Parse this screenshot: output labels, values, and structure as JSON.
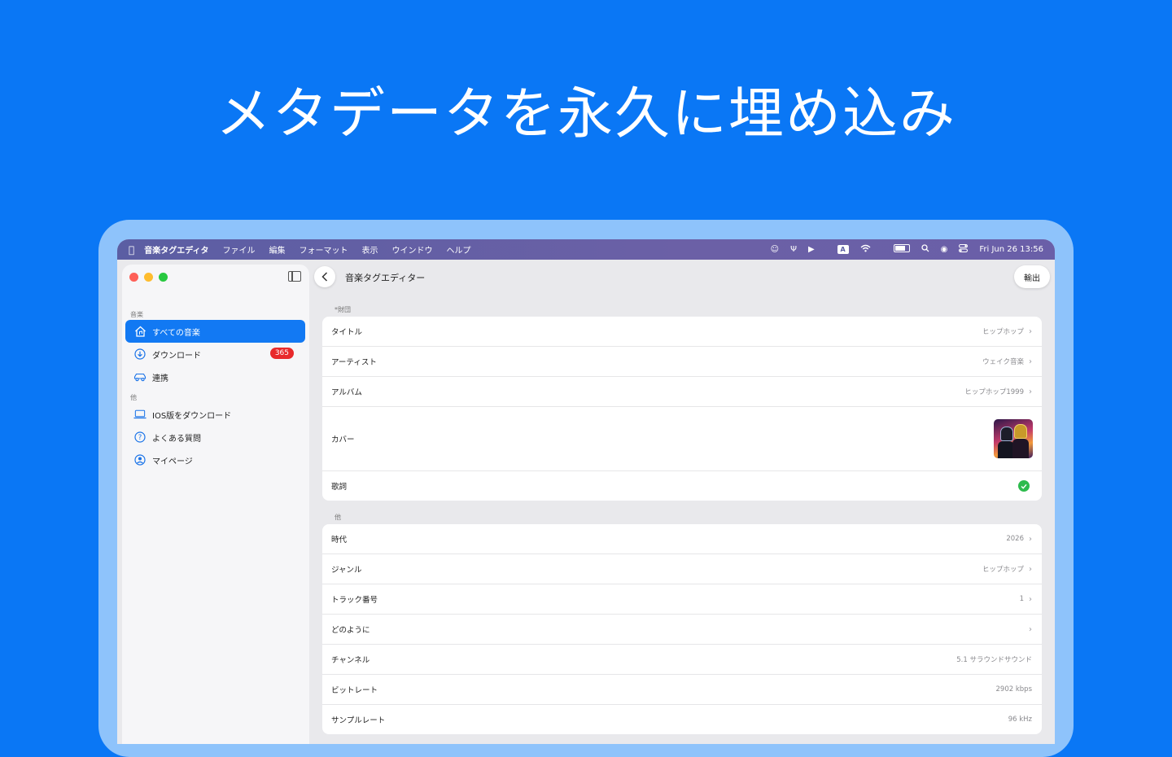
{
  "headline": "メタデータを永久に埋め込み",
  "menubar": {
    "app_name": "音楽タグエディタ",
    "items": [
      "ファイル",
      "編集",
      "フォーマット",
      "表示",
      "ウインドウ",
      "ヘルプ"
    ],
    "input_indicator": "A",
    "clock": "Fri Jun 26  13:56"
  },
  "sidebar": {
    "section_music": "音楽",
    "items_music": [
      {
        "label": "すべての音楽",
        "icon": "home-music-icon",
        "active": true
      },
      {
        "label": "ダウンロード",
        "icon": "download-icon",
        "badge": "365"
      },
      {
        "label": "連携",
        "icon": "car-icon"
      }
    ],
    "section_other": "他",
    "items_other": [
      {
        "label": "IOS版をダウンロード",
        "icon": "laptop-icon"
      },
      {
        "label": "よくある質問",
        "icon": "question-icon"
      },
      {
        "label": "マイページ",
        "icon": "person-icon"
      }
    ]
  },
  "main": {
    "title": "音楽タグエディター",
    "export_label": "輸出",
    "group1_label": "*財団",
    "group1_rows": [
      {
        "label": "タイトル",
        "value": "ヒップホップ"
      },
      {
        "label": "アーティスト",
        "value": "ウェイク音楽"
      },
      {
        "label": "アルバム",
        "value": "ヒップホップ1999"
      },
      {
        "label": "カバー"
      },
      {
        "label": "歌詞"
      }
    ],
    "group2_label": "他",
    "group2_rows": [
      {
        "label": "時代",
        "value": "2026",
        "chevron": true
      },
      {
        "label": "ジャンル",
        "value": "ヒップホップ",
        "chevron": true
      },
      {
        "label": "トラック番号",
        "value": "1",
        "chevron": true
      },
      {
        "label": "どのように",
        "value": "",
        "chevron": true
      },
      {
        "label": "チャンネル",
        "value": "5.1 サラウンドサウンド"
      },
      {
        "label": "ビットレート",
        "value": "2902 kbps"
      },
      {
        "label": "サンプルレート",
        "value": "96 kHz"
      }
    ]
  },
  "colors": {
    "background": "#0a77f5",
    "accent": "#1279f3",
    "badge": "#e8292b",
    "check": "#2dbb4d"
  }
}
